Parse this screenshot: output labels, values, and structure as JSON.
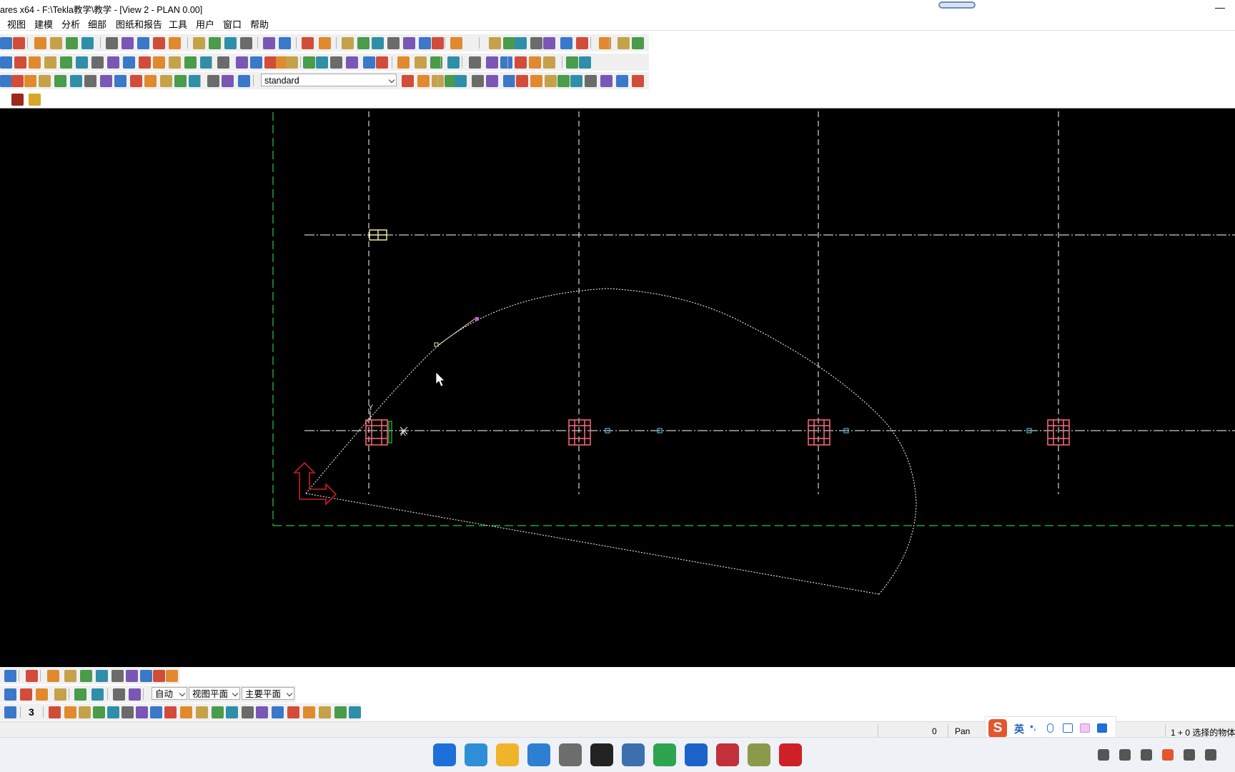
{
  "window": {
    "title": "ares x64 - F:\\Tekla教学\\教学 - [View 2 - PLAN 0.00]",
    "minimize_glyph": "—"
  },
  "menu": {
    "items": [
      "视图",
      "建模",
      "分析",
      "细部",
      "图纸和报告",
      "工具",
      "用户",
      "窗口",
      "帮助"
    ]
  },
  "toolbar": {
    "phase_select_value": "standard"
  },
  "bottom_toolbar": {
    "row2_selects": [
      "自动",
      "视图平面",
      "主要平面"
    ],
    "row3_label": "3"
  },
  "status": {
    "value": "0",
    "mode": "Pan",
    "selection_info": "1 + 0 选择的物体"
  },
  "ime": {
    "logo": "S",
    "lang": "英"
  },
  "canvas": {
    "background": "#000000",
    "grid_color": "#ffffff",
    "work_area_color": "#1fa13a",
    "column_color": "#ff6b7a",
    "axis_color": "#cc1f1f",
    "axis_x_label": "X",
    "axis_y_label": "Y"
  },
  "taskbar": {
    "apps": [
      "windows-start",
      "edge",
      "file-explorer",
      "copilot",
      "calculator",
      "media-player",
      "snipping-tool",
      "green-app",
      "k-app",
      "tekla-structures",
      "sheet-app",
      "autocad"
    ]
  }
}
